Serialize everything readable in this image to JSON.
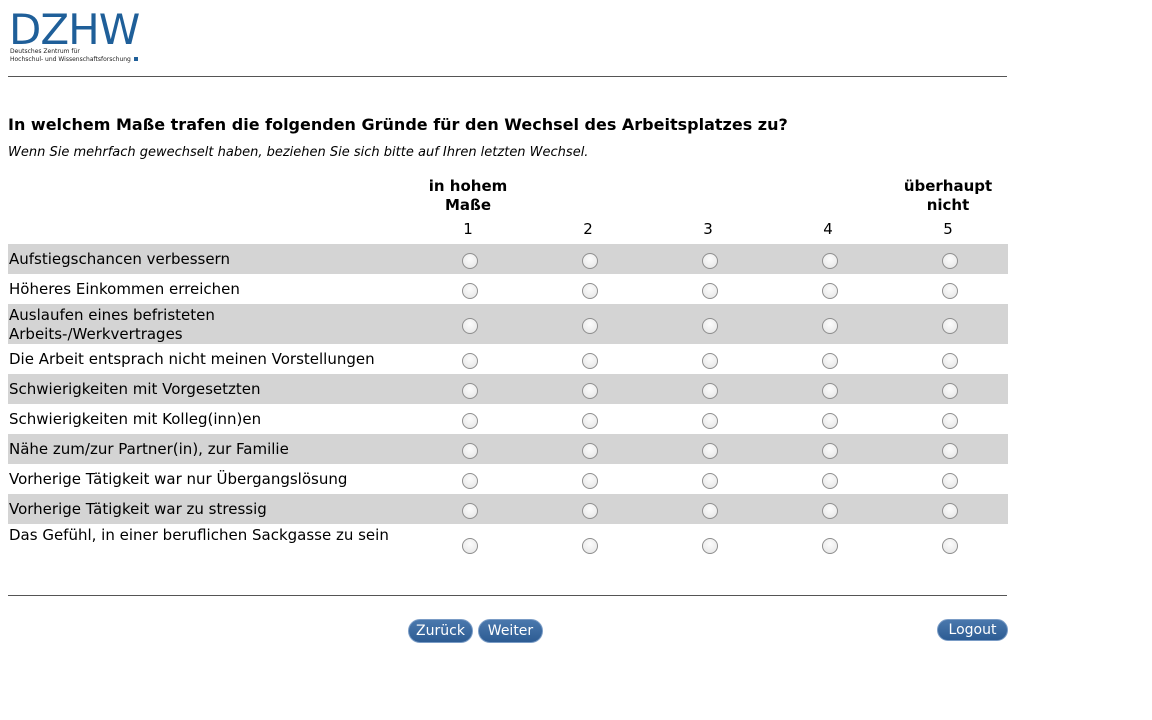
{
  "logo": {
    "letters": "DZHW",
    "line1": "Deutsches Zentrum für",
    "line2": "Hochschul- und Wissenschaftsforschung"
  },
  "question": "In welchem Maße trafen die folgenden Gründe für den Wechsel des Arbeitsplatzes zu?",
  "instruction": "Wenn Sie mehrfach gewechselt haben, beziehen Sie sich bitte auf Ihren letzten Wechsel.",
  "scale": {
    "left_anchor_line1": "in hohem",
    "left_anchor_line2": "Maße",
    "right_anchor_line1": "überhaupt",
    "right_anchor_line2": "nicht",
    "points": [
      "1",
      "2",
      "3",
      "4",
      "5"
    ]
  },
  "items": [
    {
      "label": "Aufstiegschancen verbessern"
    },
    {
      "label": "Höheres Einkommen erreichen"
    },
    {
      "label": "Auslaufen eines befristeten Arbeits-/Werkvertrages"
    },
    {
      "label": "Die Arbeit entsprach nicht meinen Vorstellungen"
    },
    {
      "label": "Schwierigkeiten mit Vorgesetzten"
    },
    {
      "label": "Schwierigkeiten mit Kolleg(inn)en"
    },
    {
      "label": "Nähe zum/zur Partner(in), zur Familie"
    },
    {
      "label": "Vorherige Tätigkeit war nur Übergangslösung"
    },
    {
      "label": "Vorherige Tätigkeit war zu stressig"
    },
    {
      "label": "Das Gefühl, in einer beruflichen Sackgasse zu sein"
    }
  ],
  "buttons": {
    "back": "Zurück",
    "next": "Weiter",
    "logout": "Logout"
  },
  "colors": {
    "brand": "#1f5f99",
    "button": "#3a6aa1",
    "row_shade": "#d4d4d4"
  }
}
